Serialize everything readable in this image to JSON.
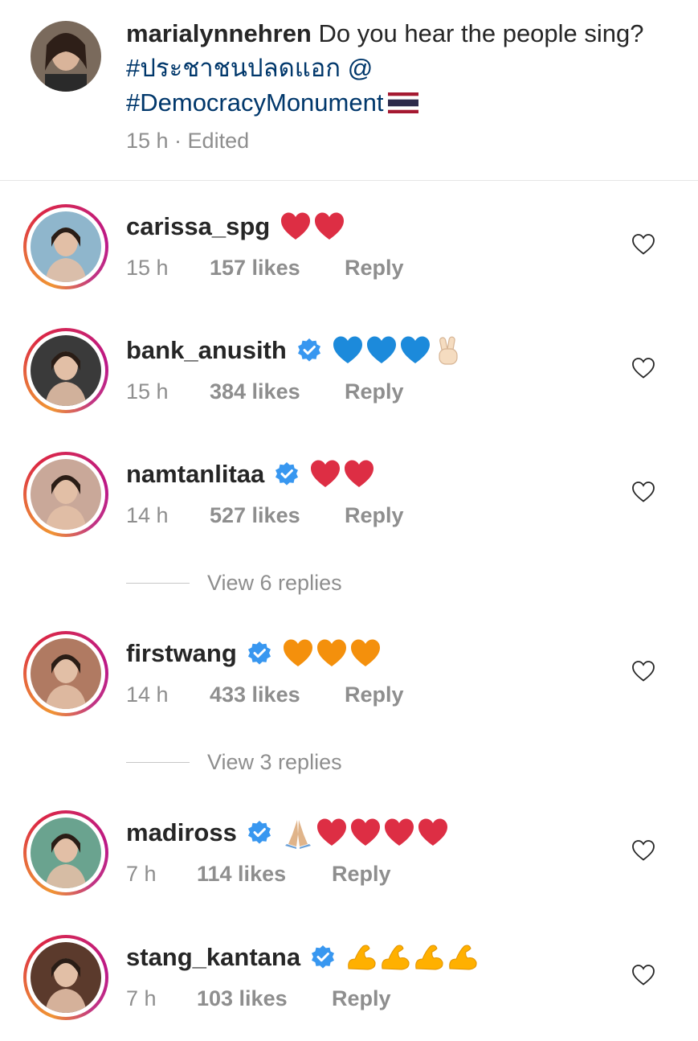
{
  "caption": {
    "username": "marialynnehren",
    "text_plain": "Do you hear the people sing?",
    "hashtag_thai": "#ประชาชนปลดแอก",
    "at_symbol": "@",
    "hashtag_place": "#DemocracyMonument",
    "flag": "🇹🇭",
    "meta": "15 h · Edited"
  },
  "comments": [
    {
      "username": "carissa_spg",
      "verified": false,
      "emojis": [
        "heart-red",
        "heart-red"
      ],
      "time": "15 h",
      "likes": "157 likes",
      "reply_label": "Reply",
      "avatar_color": "#8fb6cc"
    },
    {
      "username": "bank_anusith",
      "verified": true,
      "emojis": [
        "heart-blue",
        "heart-blue",
        "heart-blue",
        "victory-hand"
      ],
      "time": "15 h",
      "likes": "384 likes",
      "reply_label": "Reply",
      "avatar_color": "#3a3a3a"
    },
    {
      "username": "namtanlitaa",
      "verified": true,
      "emojis": [
        "heart-red",
        "heart-red"
      ],
      "time": "14 h",
      "likes": "527 likes",
      "reply_label": "Reply",
      "avatar_color": "#c9a899",
      "view_replies": "View 6 replies"
    },
    {
      "username": "firstwang",
      "verified": true,
      "emojis": [
        "heart-orange",
        "heart-orange",
        "heart-orange"
      ],
      "time": "14 h",
      "likes": "433 likes",
      "reply_label": "Reply",
      "avatar_color": "#b07a62",
      "view_replies": "View 3 replies"
    },
    {
      "username": "madiross",
      "verified": true,
      "emojis": [
        "folded-hands",
        "heart-red",
        "heart-red",
        "heart-red",
        "heart-red"
      ],
      "time": "7 h",
      "likes": "114 likes",
      "reply_label": "Reply",
      "avatar_color": "#6aa38f"
    },
    {
      "username": "stang_kantana",
      "verified": true,
      "emojis": [
        "flexed-biceps",
        "flexed-biceps",
        "flexed-biceps",
        "flexed-biceps"
      ],
      "time": "7 h",
      "likes": "103 likes",
      "reply_label": "Reply",
      "avatar_color": "#5b3a2c"
    }
  ],
  "colors": {
    "text": "#262626",
    "secondary": "#8e8e8e",
    "link": "#00376b",
    "verified": "#3897f0",
    "heart_red": "#dd2e44",
    "heart_blue": "#1c8adb",
    "heart_orange": "#f4900c",
    "biceps": "#ffb000"
  }
}
